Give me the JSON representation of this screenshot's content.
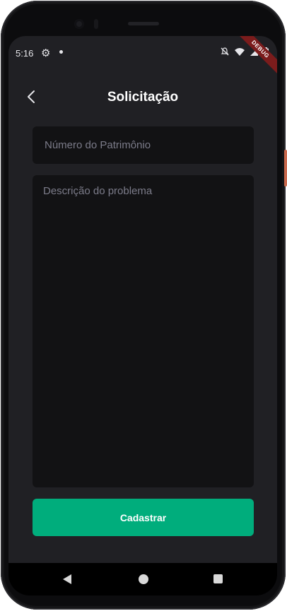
{
  "status_bar": {
    "time": "5:16",
    "icons": [
      "gear-icon",
      "notification-dot-icon",
      "mute-icon",
      "wifi-icon",
      "signal-icon",
      "battery-icon"
    ],
    "debug_banner": "DEBUG"
  },
  "header": {
    "back_icon": "chevron-left-icon",
    "title": "Solicitação"
  },
  "form": {
    "patrimonio": {
      "placeholder": "Número do Patrimônio",
      "value": ""
    },
    "descricao": {
      "placeholder": "Descrição do problema",
      "value": ""
    },
    "submit_label": "Cadastrar"
  },
  "nav_bar": {
    "icons": [
      "back-triangle-icon",
      "home-circle-icon",
      "recents-square-icon"
    ]
  },
  "colors": {
    "background": "#202024",
    "input_background": "#121214",
    "accent": "#00ad7c",
    "placeholder": "#7c7c8a",
    "debug_banner": "#7b1c1c"
  }
}
